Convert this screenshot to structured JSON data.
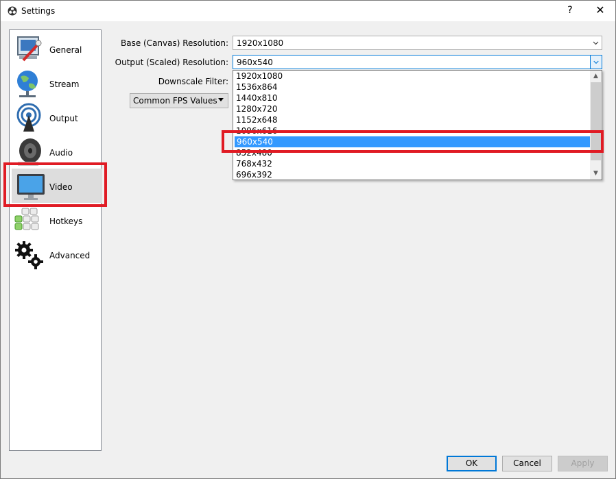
{
  "window": {
    "title": "Settings",
    "help_glyph": "?",
    "close_glyph": "✕"
  },
  "sidebar": {
    "items": [
      {
        "label": "General",
        "icon": "general-icon"
      },
      {
        "label": "Stream",
        "icon": "globe-icon"
      },
      {
        "label": "Output",
        "icon": "broadcast-icon"
      },
      {
        "label": "Audio",
        "icon": "speaker-icon"
      },
      {
        "label": "Video",
        "icon": "monitor-icon",
        "active": true
      },
      {
        "label": "Hotkeys",
        "icon": "keyboard-icon"
      },
      {
        "label": "Advanced",
        "icon": "gears-icon"
      }
    ]
  },
  "video": {
    "base_label": "Base (Canvas) Resolution:",
    "base_value": "1920x1080",
    "output_label": "Output (Scaled) Resolution:",
    "output_value": "960x540",
    "downscale_label": "Downscale Filter:",
    "fps_label": "Common FPS Values"
  },
  "dropdown": {
    "options": [
      "1920x1080",
      "1536x864",
      "1440x810",
      "1280x720",
      "1152x648",
      "1096x616",
      "960x540",
      "852x480",
      "768x432",
      "696x392"
    ],
    "selected": "960x540"
  },
  "buttons": {
    "ok": "OK",
    "cancel": "Cancel",
    "apply": "Apply"
  },
  "colors": {
    "highlight_box": "#e01b24",
    "selection": "#3399ff",
    "focus": "#0078d7"
  }
}
